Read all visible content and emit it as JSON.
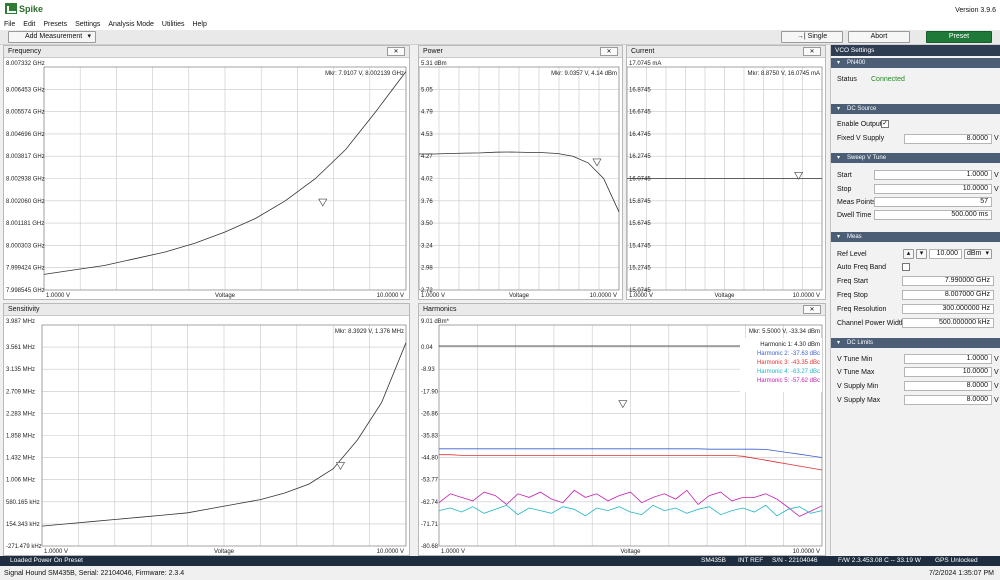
{
  "app": {
    "name": "Spike",
    "version": "Version 3.9.6"
  },
  "menu": [
    "File",
    "Edit",
    "Presets",
    "Settings",
    "Analysis Mode",
    "Utilities",
    "Help"
  ],
  "toolbar": {
    "add_measurement": "Add Measurement",
    "single": "Single",
    "abort": "Abort",
    "preset": "Preset",
    "close": "✕"
  },
  "panels": {
    "frequency": {
      "title": "Frequency",
      "marker": "Mkr: 7.9107 V, 8.002139 GHz",
      "ylabels": [
        "8.007332 GHz",
        "8.006453 GHz",
        "8.005574 GHz",
        "8.004696 GHz",
        "8.003817 GHz",
        "8.002938 GHz",
        "8.002060 GHz",
        "8.001181 GHz",
        "8.000303 GHz",
        "7.999424 GHz",
        "7.998545 GHz"
      ],
      "xleft": "1.0000 V",
      "xmid": "Voltage",
      "xright": "10.0000 V",
      "trace": [
        0.07,
        0.09,
        0.11,
        0.14,
        0.17,
        0.21,
        0.26,
        0.32,
        0.4,
        0.5,
        0.63,
        0.8,
        0.98
      ],
      "marker_frac": [
        0.77,
        0.39
      ]
    },
    "power": {
      "title": "Power",
      "marker": "Mkr: 9.0357 V, 4.14 dBm",
      "ylabels": [
        "5.31 dBm",
        "5.05",
        "4.79",
        "4.53",
        "4.27",
        "4.02",
        "3.76",
        "3.50",
        "3.24",
        "2.98",
        "2.72"
      ],
      "xleft": "1.0000 V",
      "xmid": "Voltage",
      "xright": "10.0000 V",
      "trace": [
        0.61,
        0.61,
        0.612,
        0.614,
        0.615,
        0.618,
        0.619,
        0.617,
        0.616,
        0.612,
        0.6,
        0.57,
        0.5,
        0.35
      ],
      "marker_frac": [
        0.89,
        0.57
      ]
    },
    "current": {
      "title": "Current",
      "marker": "Mkr: 8.8750 V, 16.0745 mA",
      "ylabels": [
        "17.0745 mA",
        "16.8745",
        "16.6745",
        "16.4745",
        "16.2745",
        "16.0745",
        "15.8745",
        "15.6745",
        "15.4745",
        "15.2745",
        "15.0745"
      ],
      "xleft": "1.0000 V",
      "xmid": "Voltage",
      "xright": "10.0000 V",
      "trace": [
        0.5,
        0.5
      ],
      "marker_frac": [
        0.88,
        0.51
      ]
    },
    "sensitivity": {
      "title": "Sensitivity",
      "marker": "Mkr: 8.3929 V, 1.376 MHz",
      "ylabels": [
        "3.987 MHz",
        "3.561 MHz",
        "3.135 MHz",
        "2.709 MHz",
        "2.283 MHz",
        "1.858 MHz",
        "1.432 MHz",
        "1.006 MHz",
        "580.165 kHz",
        "154.343 kHz",
        "-271.479 kHz"
      ],
      "xleft": "1.0000 V",
      "xmid": "Voltage",
      "xright": "10.0000 V",
      "trace": [
        0.09,
        0.1,
        0.11,
        0.12,
        0.13,
        0.14,
        0.15,
        0.17,
        0.19,
        0.21,
        0.24,
        0.28,
        0.35,
        0.48,
        0.65,
        0.92
      ],
      "marker_frac": [
        0.82,
        0.36
      ]
    },
    "harmonics": {
      "title": "Harmonics",
      "marker": "Mkr: 5.5000 V, -33.34 dBm",
      "ylabels": [
        "9.01 dBm*",
        "0.04",
        "-8.93",
        "-17.90",
        "-26.86",
        "-35.83",
        "-44.80",
        "-53.77",
        "-62.74",
        "-71.71",
        "-80.68"
      ],
      "xleft": "1.0000 V",
      "xmid": "Voltage",
      "xright": "10.0000 V",
      "legend": [
        {
          "label": "Harmonic 1: 4.30 dBm",
          "color": "#222222"
        },
        {
          "label": "Harmonic 2: -37.63 dBc",
          "color": "#3a5fd0"
        },
        {
          "label": "Harmonic 3: -43.35 dBc",
          "color": "#e03030"
        },
        {
          "label": "Harmonic 4: -63.27 dBc",
          "color": "#22b5c5"
        },
        {
          "label": "Harmonic 5: -57.62 dBc",
          "color": "#c51fb0"
        }
      ],
      "marker_frac": [
        0.48,
        0.64
      ]
    }
  },
  "side": {
    "vco_settings": "VCO Settings",
    "pn400": "PN400",
    "status_label": "Status",
    "status_value": "Connected",
    "dc_source": "DC Source",
    "enable_output": "Enable Output",
    "enable_checked": "✓",
    "fixed_v_supply": "Fixed V Supply",
    "fixed_v_value": "8.0000",
    "unit_v": "V",
    "sweep": "Sweep V Tune",
    "start": "Start",
    "start_value": "1.0000",
    "stop": "Stop",
    "stop_value": "10.0000",
    "meas_points": "Meas Points",
    "meas_points_value": "57",
    "dwell": "Dwell Time",
    "dwell_value": "500.000 ms",
    "meas": "Meas",
    "ref_level": "Ref Level",
    "ref_value": "10.000",
    "ref_unit": "dBm",
    "auto_freq_band": "Auto Freq Band",
    "freq_start": "Freq Start",
    "freq_start_value": "7.990000 GHz",
    "freq_stop": "Freq Stop",
    "freq_stop_value": "8.007000 GHz",
    "freq_res": "Freq Resolution",
    "freq_res_value": "300.000000 Hz",
    "cpw": "Channel Power Width",
    "cpw_value": "500.000000 kHz",
    "dc_limits": "DC Limits",
    "vtune_min": "V Tune Min",
    "vtune_min_value": "1.0000",
    "vtune_max": "V Tune Max",
    "vtune_max_value": "10.0000",
    "vsupply_min": "V Supply Min",
    "vsupply_min_value": "8.0000",
    "vsupply_max": "V Supply Max",
    "vsupply_max_value": "8.0000"
  },
  "status": {
    "message": "Loaded Power On Preset",
    "model": "SM435B",
    "ref": "INT REF",
    "serial": "S/N - 22104046",
    "fw": "F/W 2.3.4",
    "temp": "53.08 C -- 33.19 W",
    "gps": "GPS Unlocked"
  },
  "footer": {
    "left": "Signal Hound SM435B, Serial: 22104046, Firmware: 2.3.4",
    "right": "7/2/2024 1:35:07 PM"
  },
  "colors": {
    "accent": "#1f7a3a",
    "section": "#4b5e76",
    "status_bar": "#1e2d3f",
    "connected": "#1f8a1f"
  }
}
